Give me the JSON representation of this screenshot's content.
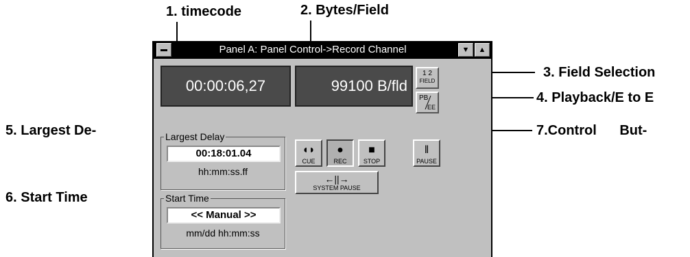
{
  "callouts": {
    "timecode": "1. timecode",
    "bytes_field": "2. Bytes/Field",
    "field_selection": "3. Field Selection",
    "playback": "4. Playback/E to E",
    "largest_delay": "5. Largest De-",
    "start_time": "6. Start Time",
    "control_buttons": "7.Control But-"
  },
  "window": {
    "title": "Panel A: Panel Control->Record Channel",
    "scroll_down": "▼",
    "scroll_up": "▲"
  },
  "displays": {
    "timecode": "00:00:06,27",
    "bytes": "99100 B/fld"
  },
  "side_buttons": {
    "field_top": "1 2",
    "field_bottom": "FIELD",
    "pbee_top": "PB",
    "pbee_bottom": "EE"
  },
  "largest_delay": {
    "legend": "Largest Delay",
    "value": "00:18:01.04",
    "format": "hh:mm:ss.ff"
  },
  "start_time": {
    "legend": "Start Time",
    "value": "<< Manual >>",
    "format": "mm/dd hh:mm:ss"
  },
  "controls": {
    "cue": "CUE",
    "rec": "REC",
    "stop": "STOP",
    "pause": "PAUSE",
    "system_pause": "SYSTEM PAUSE"
  }
}
